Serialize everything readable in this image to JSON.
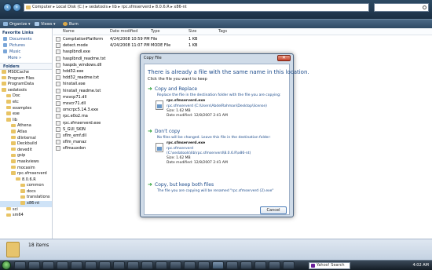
{
  "explorer": {
    "address": "Computer  ▸  Local Disk (C:)  ▸  sedatools  ▸  lib  ▸  rpc.sfmserverd  ▸  8.0.6.R  ▸  x86-nt",
    "toolbar": {
      "organize": "Organize ▾",
      "views": "Views ▾",
      "burn": "Burn"
    },
    "favorites": {
      "header": "Favorite Links",
      "items": [
        "Documents",
        "Pictures",
        "Music"
      ],
      "more": "More »"
    },
    "folders_header": "Folders",
    "tree": [
      "MSOCache",
      "Program Files",
      "ProgramData",
      "sedatools",
      "Doc",
      "etc",
      "examples",
      "exe",
      "lib",
      "Athena",
      "Atlas",
      "dlinternal",
      "Deckbuild",
      "devedit",
      "gsip",
      "maskviews",
      "mocasim",
      "rpc.sfmserverd",
      "8.0.6.R",
      "common",
      "docs",
      "translations",
      "x86-nt",
      "sci",
      "sm64"
    ],
    "columns": [
      "Name",
      "Date modified",
      "Type",
      "Size",
      "Tags"
    ],
    "files": [
      {
        "name": "CompilationPlatform",
        "date": "4/24/2008 10:59 PM",
        "type": "File",
        "size": "1 KB"
      },
      {
        "name": "detect.mode",
        "date": "4/24/2008 11:07 PM",
        "type": "MODE File",
        "size": "1 KB"
      },
      {
        "name": "hasplbndl.exe",
        "date": "",
        "type": "",
        "size": ""
      },
      {
        "name": "hasplbndl_readme.txt",
        "date": "",
        "type": "",
        "size": ""
      },
      {
        "name": "haspds_windows.dll",
        "date": "",
        "type": "",
        "size": ""
      },
      {
        "name": "hdd32.exe",
        "date": "",
        "type": "",
        "size": ""
      },
      {
        "name": "hdd32_readme.txt",
        "date": "",
        "type": "",
        "size": ""
      },
      {
        "name": "hinstall.exe",
        "date": "",
        "type": "",
        "size": ""
      },
      {
        "name": "hinstall_readme.txt",
        "date": "",
        "type": "",
        "size": ""
      },
      {
        "name": "msvcp71.dll",
        "date": "",
        "type": "",
        "size": ""
      },
      {
        "name": "msvcr71.dll",
        "date": "",
        "type": "",
        "size": ""
      },
      {
        "name": "omcrpc5.14.3.exe",
        "date": "",
        "type": "",
        "size": ""
      },
      {
        "name": "rpc.e0o2.rna",
        "date": "",
        "type": "",
        "size": ""
      },
      {
        "name": "rpc.sfmserverd.exe",
        "date": "",
        "type": "",
        "size": ""
      },
      {
        "name": "S_GUI_SKIN",
        "date": "",
        "type": "",
        "size": ""
      },
      {
        "name": "sflm_emf.dll",
        "date": "",
        "type": "",
        "size": ""
      },
      {
        "name": "sflm_manaz",
        "date": "",
        "type": "",
        "size": ""
      },
      {
        "name": "sflmauxdon",
        "date": "",
        "type": "",
        "size": ""
      }
    ],
    "status": "18 items"
  },
  "dialog": {
    "title": "Copy File",
    "close": "✕",
    "heading": "There is already a file with the same name in this location.",
    "subheading": "Click the file you want to keep",
    "copy_replace": {
      "title": "Copy and Replace",
      "desc": "Replace the file in the destination folder with the file you are copying:",
      "filename": "rpc.sfmserverd.exe",
      "path": "rpc.sfmserverd (C:\\Users\\AbdelRahman\\Desktop\\license)",
      "size": "Size: 1.62 MB",
      "date": "Date modified: 12/8/2007 2:41 AM"
    },
    "dont_copy": {
      "title": "Don't copy",
      "desc": "No files will be changed. Leave this file in the destination folder:",
      "filename": "rpc.sfmserverd.exe",
      "path1": "rpc.sfmserverd",
      "path2": "(C:\\sedatools\\lib\\rpc.sfmserverd\\8.0.6.R\\x86-nt)",
      "size": "Size: 1.62 MB",
      "date": "Date modified: 12/8/2007 2:41 AM"
    },
    "keep_both": {
      "title": "Copy, but keep both files",
      "desc": "The file you are copying will be renamed \"rpc.sfmserverd (2).exe\""
    },
    "cancel": "Cancel"
  },
  "taskbar": {
    "search_placeholder": "Yahoo! Search",
    "clock": "4:02 AM"
  }
}
